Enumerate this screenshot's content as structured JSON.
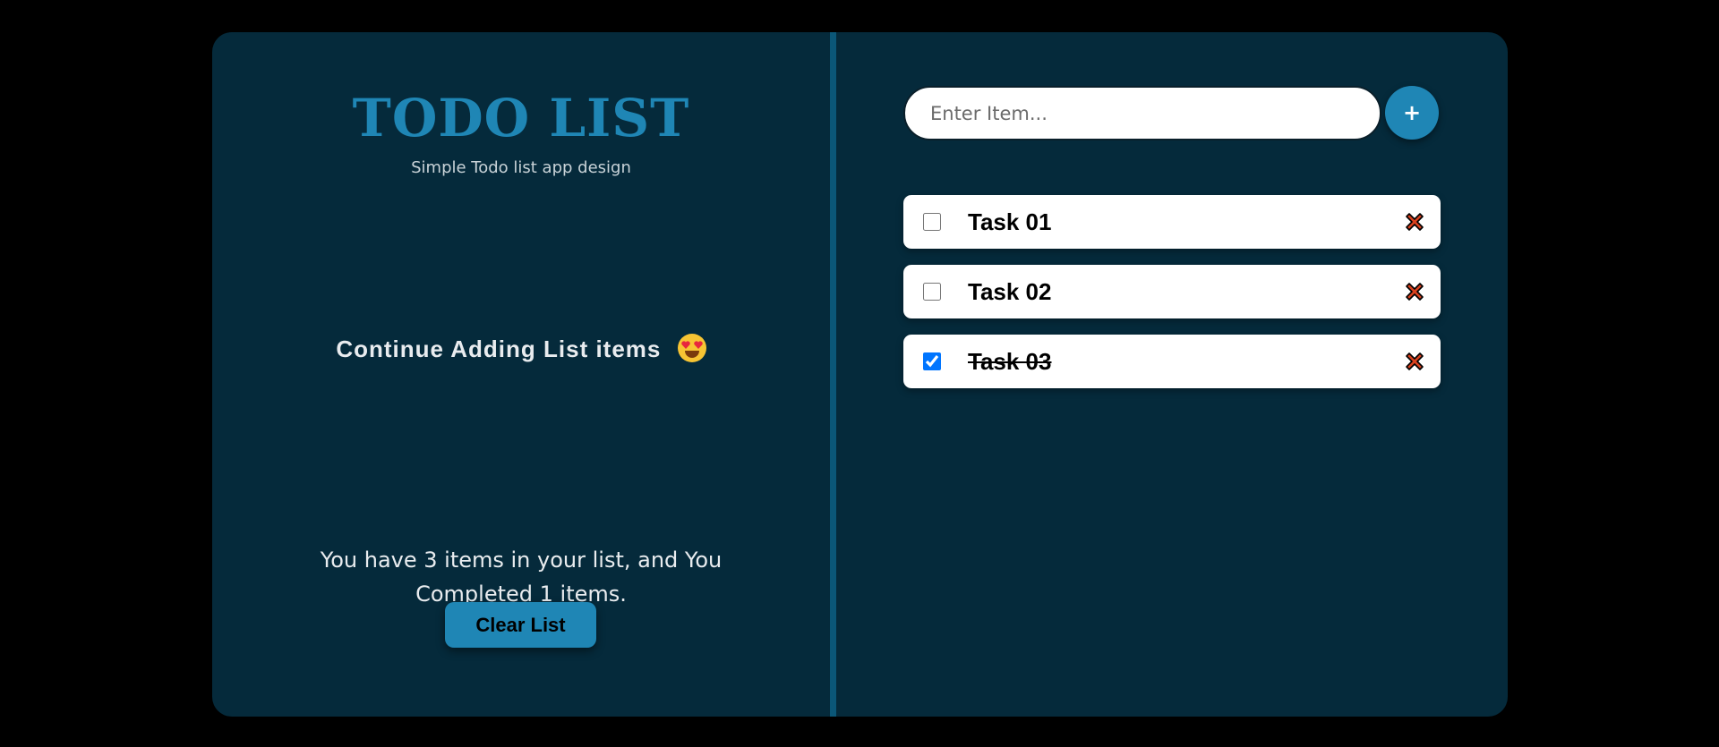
{
  "app": {
    "title": "TODO LIST",
    "subtitle": "Simple Todo list app design"
  },
  "left": {
    "continue_message": "Continue Adding List items",
    "emoji": "smiling-face-with-heart-eyes",
    "summary_line1": "You have 3 items in your list, and You",
    "summary_line2": "Completed 1 items.",
    "clear_button": "Clear List"
  },
  "right": {
    "input_placeholder": "Enter Item...",
    "input_value": "",
    "add_button": "+",
    "tasks": [
      {
        "label": "Task 01",
        "checked": false
      },
      {
        "label": "Task 02",
        "checked": false
      },
      {
        "label": "Task 03",
        "checked": true
      }
    ]
  },
  "colors": {
    "page_background": "#000000",
    "card_background": "#052a3b",
    "divider": "#0b5778",
    "accent": "#1f86b5",
    "delete_icon": "#d8411e"
  }
}
